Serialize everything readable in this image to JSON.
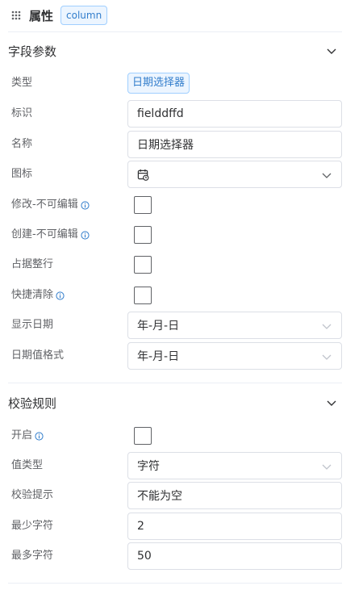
{
  "header": {
    "title": "属性",
    "tag": "column"
  },
  "sections": {
    "field": {
      "title": "字段参数",
      "type_label": "类型",
      "type_value": "日期选择器",
      "id_label": "标识",
      "id_value": "fielddffd",
      "name_label": "名称",
      "name_value": "日期选择器",
      "icon_label": "图标",
      "icon_value": "calendar-clock-icon",
      "edit_readonly_label": "修改-不可编辑",
      "create_readonly_label": "创建-不可编辑",
      "full_row_label": "占据整行",
      "quick_clear_label": "快捷清除",
      "display_date_label": "显示日期",
      "display_date_value": "年-月-日",
      "date_format_label": "日期值格式",
      "date_format_value": "年-月-日"
    },
    "validation": {
      "title": "校验规则",
      "enable_label": "开启",
      "value_type_label": "值类型",
      "value_type_value": "字符",
      "hint_label": "校验提示",
      "hint_value": "不能为空",
      "min_label": "最少字符",
      "min_value": "2",
      "max_label": "最多字符",
      "max_value": "50"
    }
  },
  "colors": {
    "accent": "#337ecc",
    "tag_bg": "#ecf5ff",
    "tag_border": "#a0cfff",
    "border": "#dcdfe6",
    "label": "#606266"
  }
}
